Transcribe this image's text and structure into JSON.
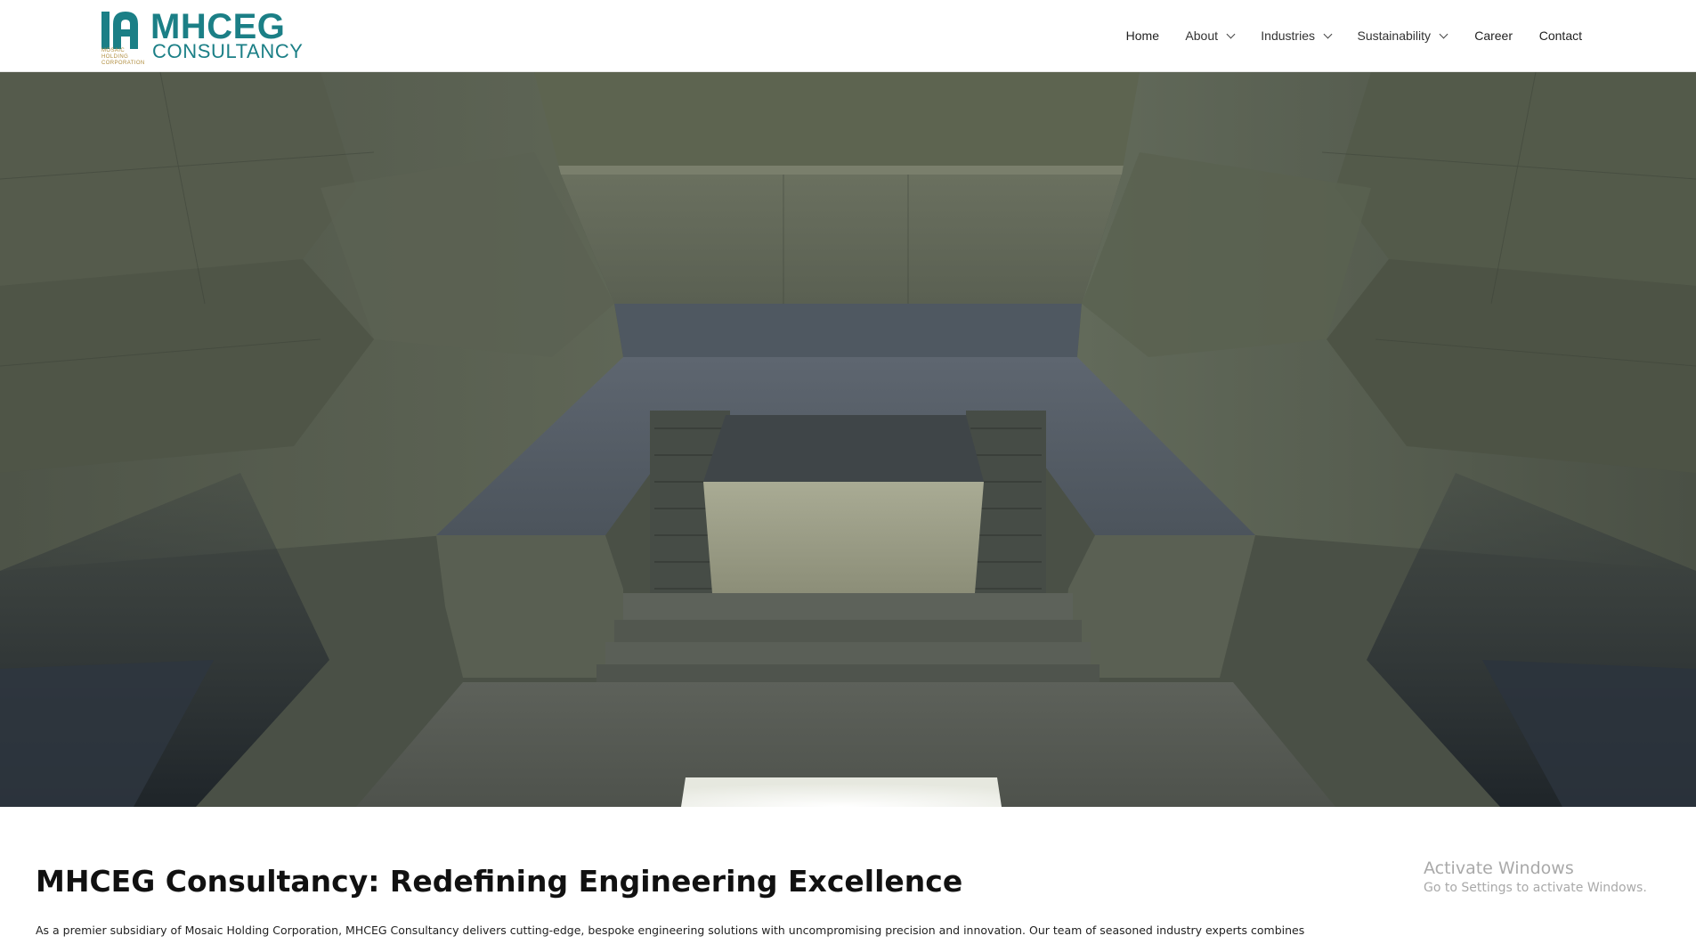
{
  "brand": {
    "name_line1": "MHCEG",
    "name_line2": "CONSULTANCY",
    "tagline": "Mosaic Holding Corporation",
    "primary_color": "#1b7f86",
    "accent_color": "#b08d3e"
  },
  "nav": {
    "items": [
      {
        "label": "Home",
        "has_dropdown": false
      },
      {
        "label": "About",
        "has_dropdown": true
      },
      {
        "label": "Industries",
        "has_dropdown": true
      },
      {
        "label": "Sustainability",
        "has_dropdown": true
      },
      {
        "label": "Career",
        "has_dropdown": false
      },
      {
        "label": "Contact",
        "has_dropdown": false
      }
    ]
  },
  "hero": {
    "image_subject": "concrete-chamber-render"
  },
  "content": {
    "title": "MHCEG Consultancy: Redefining Engineering Excellence",
    "body": "As a premier subsidiary of Mosaic Holding Corporation, MHCEG Consultancy delivers cutting-edge, bespoke engineering solutions with uncompromising precision and innovation. Our team of seasoned industry experts combines"
  },
  "watermark": {
    "title": "Activate Windows",
    "subtitle": "Go to Settings to activate Windows."
  }
}
